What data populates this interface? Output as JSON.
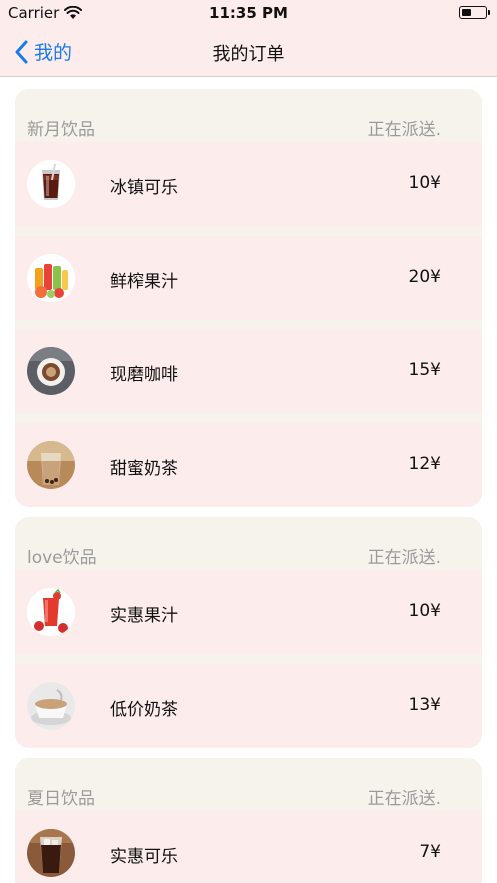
{
  "status_bar": {
    "carrier": "Carrier",
    "time": "11:35 PM"
  },
  "nav": {
    "back_label": "我的",
    "title": "我的订单"
  },
  "orders": [
    {
      "shop": "新月饮品",
      "status": "正在派送.",
      "items": [
        {
          "name": "冰镇可乐",
          "price": "10¥",
          "icon": "cola-glass-icon"
        },
        {
          "name": "鲜榨果汁",
          "price": "20¥",
          "icon": "fresh-juice-icon"
        },
        {
          "name": "现磨咖啡",
          "price": "15¥",
          "icon": "coffee-cup-icon"
        },
        {
          "name": "甜蜜奶茶",
          "price": "12¥",
          "icon": "milk-tea-icon"
        }
      ]
    },
    {
      "shop": "love饮品",
      "status": "正在派送.",
      "items": [
        {
          "name": "实惠果汁",
          "price": "10¥",
          "icon": "strawberry-juice-icon"
        },
        {
          "name": "低价奶茶",
          "price": "13¥",
          "icon": "tea-cup-icon"
        }
      ]
    },
    {
      "shop": "夏日饮品",
      "status": "正在派送.",
      "items": [
        {
          "name": "实惠可乐",
          "price": "7¥",
          "icon": "iced-cola-icon"
        }
      ]
    }
  ]
}
